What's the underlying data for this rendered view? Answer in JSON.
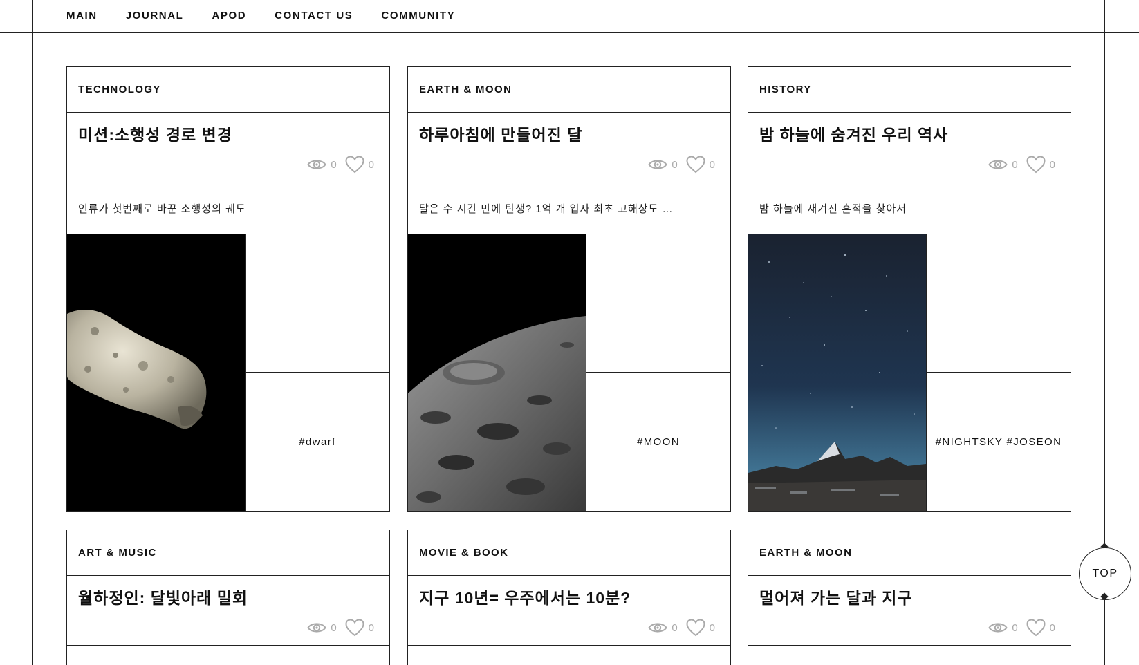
{
  "nav": {
    "items": [
      {
        "label": "MAIN"
      },
      {
        "label": "JOURNAL"
      },
      {
        "label": "APOD"
      },
      {
        "label": "CONTACT US"
      },
      {
        "label": "COMMUNITY"
      }
    ]
  },
  "cards": [
    {
      "category": "TECHNOLOGY",
      "title": "미션:소행성 경로 변경",
      "views": "0",
      "likes": "0",
      "description": "인류가 첫번째로 바꾼 소행성의 궤도",
      "tag": "#dwarf",
      "image_icon": "asteroid-image"
    },
    {
      "category": "EARTH & MOON",
      "title": "하루아침에 만들어진 달",
      "views": "0",
      "likes": "0",
      "description": "달은 수 시간 만에 탄생? 1억 개 입자 최초 고해상도 …",
      "tag": "#MOON",
      "image_icon": "moon-surface-image"
    },
    {
      "category": "HISTORY",
      "title": "밤 하늘에 숨겨진 우리 역사",
      "views": "0",
      "likes": "0",
      "description": "밤 하늘에 새겨진 흔적을 찾아서",
      "tag": "#NIGHTSKY #JOSEON",
      "image_icon": "night-sky-image"
    },
    {
      "category": "ART & MUSIC",
      "title": "월하정인: 달빛아래 밀회",
      "views": "0",
      "likes": "0"
    },
    {
      "category": "MOVIE & BOOK",
      "title": "지구 10년= 우주에서는 10분?",
      "views": "0",
      "likes": "0"
    },
    {
      "category": "EARTH & MOON",
      "title": "멀어져 가는 달과 지구",
      "views": "0",
      "likes": "0"
    }
  ],
  "top_button": {
    "label": "TOP"
  }
}
